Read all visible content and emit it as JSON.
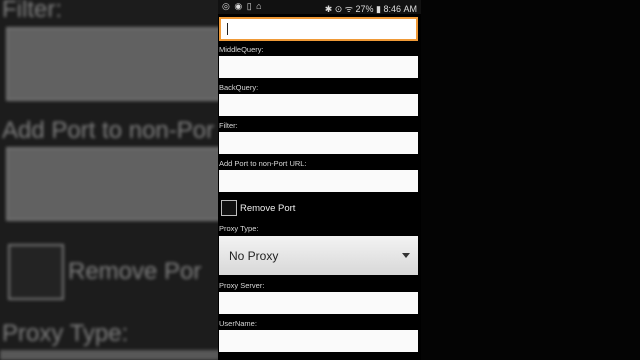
{
  "status_bar": {
    "left_icons": "◎ ◉ ▯ ⌂",
    "right": "✱ ⊙ ᯤ 27% ▮ 8:46 AM"
  },
  "background": {
    "filter": "Filter:",
    "add_port": "Add Port to non-Por",
    "remove_port": "Remove Por",
    "proxy_type": "Proxy Type:"
  },
  "form": {
    "middle_query_label": "MiddleQuery:",
    "back_query_label": "BackQuery:",
    "filter_label": "Filter:",
    "add_port_label": "Add Port to non-Port URL:",
    "remove_port_label": "Remove Port",
    "proxy_type_label": "Proxy Type:",
    "proxy_type_value": "No Proxy",
    "proxy_server_label": "Proxy Server:",
    "username_label": "UserName:"
  },
  "colors": {
    "focus_border": "#f09a37",
    "field_bg": "#fafafa",
    "screen_bg": "#000000"
  }
}
